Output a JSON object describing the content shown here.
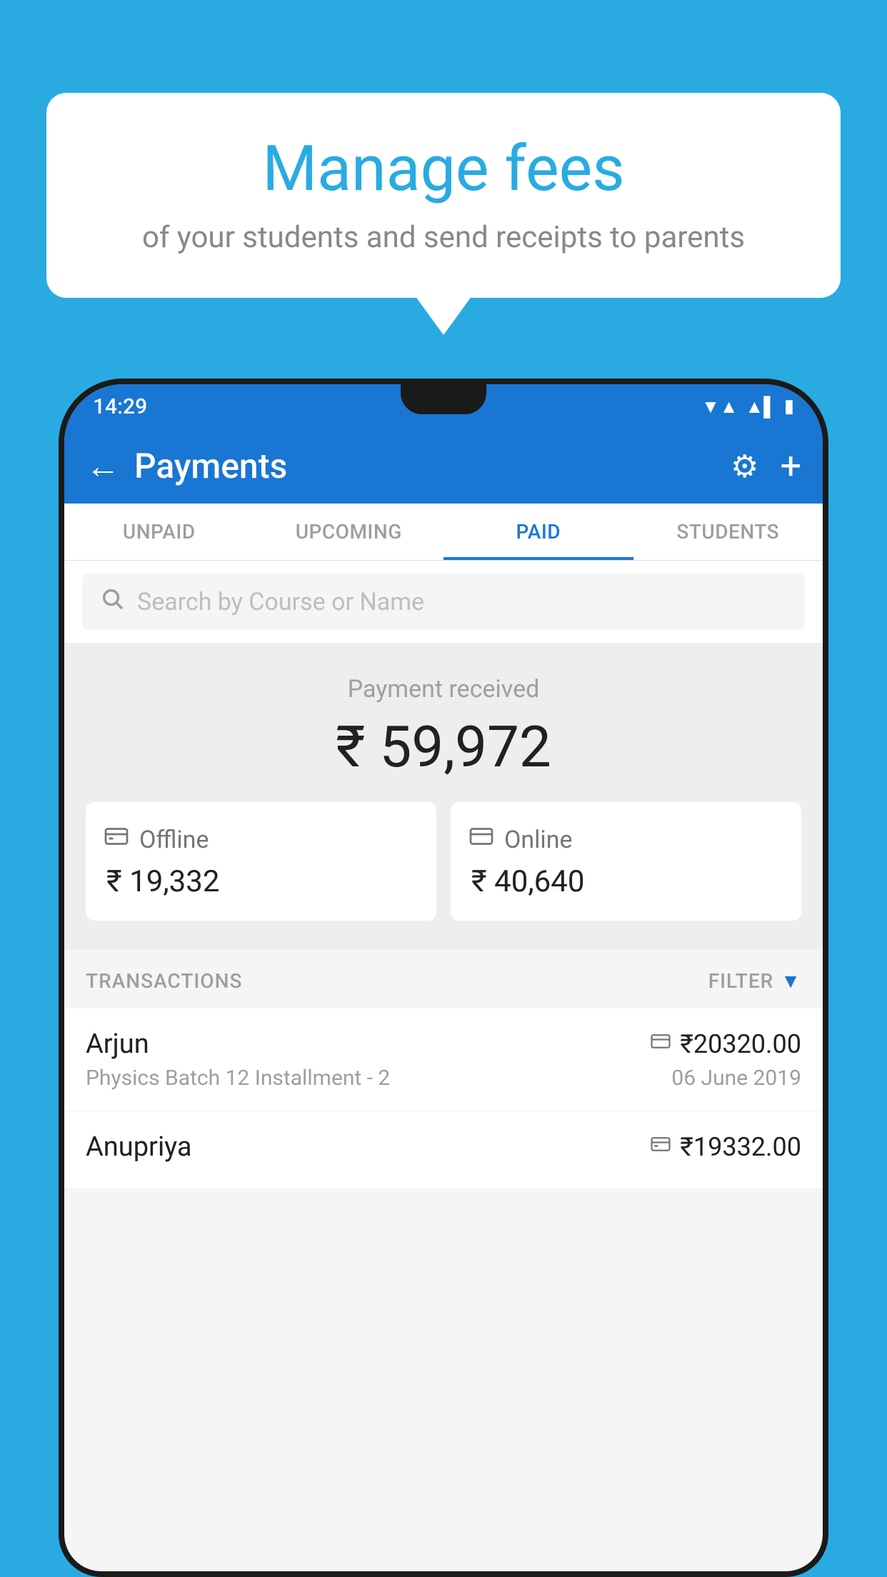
{
  "background_color": "#29ABE2",
  "speech_bubble": {
    "title": "Manage fees",
    "subtitle": "of your students and send receipts to parents"
  },
  "status_bar": {
    "time": "14:29",
    "wifi_icon": "▲",
    "signal_icon": "▲",
    "battery_icon": "▮"
  },
  "app_bar": {
    "title": "Payments",
    "back_icon": "←",
    "gear_icon": "⚙",
    "plus_icon": "+"
  },
  "tabs": [
    {
      "id": "unpaid",
      "label": "UNPAID",
      "active": false
    },
    {
      "id": "upcoming",
      "label": "UPCOMING",
      "active": false
    },
    {
      "id": "paid",
      "label": "PAID",
      "active": true
    },
    {
      "id": "students",
      "label": "STUDENTS",
      "active": false
    }
  ],
  "search": {
    "placeholder": "Search by Course or Name"
  },
  "payment_summary": {
    "label": "Payment received",
    "amount": "₹ 59,972",
    "offline": {
      "label": "Offline",
      "amount": "₹ 19,332"
    },
    "online": {
      "label": "Online",
      "amount": "₹ 40,640"
    }
  },
  "transactions_header": {
    "label": "TRANSACTIONS",
    "filter_label": "FILTER"
  },
  "transactions": [
    {
      "name": "Arjun",
      "course": "Physics Batch 12 Installment - 2",
      "amount": "₹20320.00",
      "date": "06 June 2019",
      "payment_type": "online"
    },
    {
      "name": "Anupriya",
      "course": "",
      "amount": "₹19332.00",
      "date": "",
      "payment_type": "offline"
    }
  ]
}
